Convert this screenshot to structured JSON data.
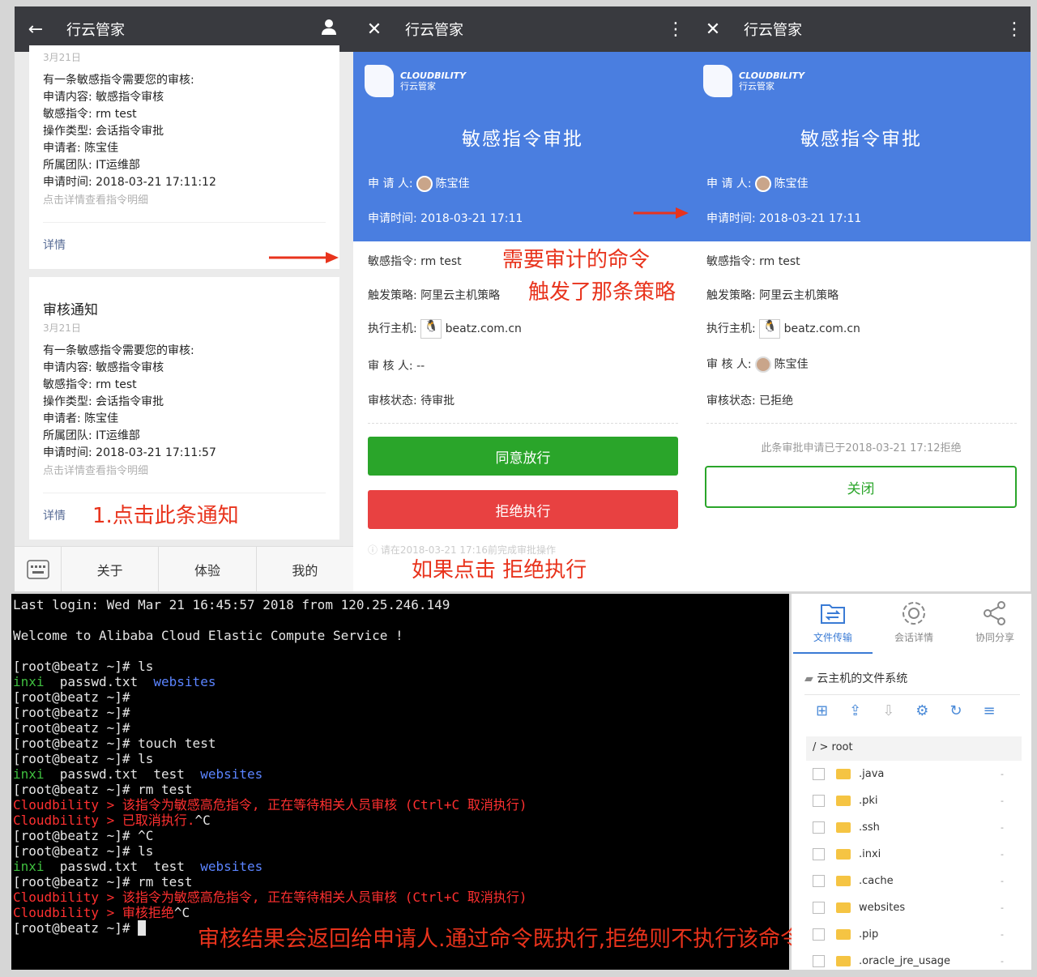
{
  "panel1": {
    "header": {
      "title": "行云管家"
    },
    "card1": {
      "date": "3月21日",
      "lines": [
        "有一条敏感指令需要您的审核:",
        "申请内容: 敏感指令审核",
        "敏感指令: rm test",
        "操作类型: 会话指令审批",
        "申请者: 陈宝佳",
        "所属团队: IT运维部",
        "申请时间: 2018-03-21 17:11:12"
      ],
      "hint": "点击详情查看指令明细",
      "detail": "详情"
    },
    "card2": {
      "title": "审核通知",
      "date": "3月21日",
      "lines": [
        "有一条敏感指令需要您的审核:",
        "申请内容: 敏感指令审核",
        "敏感指令: rm test",
        "操作类型: 会话指令审批",
        "申请者: 陈宝佳",
        "所属团队: IT运维部",
        "申请时间: 2018-03-21 17:11:57"
      ],
      "hint": "点击详情查看指令明细",
      "detail": "详情"
    },
    "annotation": "1.点击此条通知",
    "bottom_menu": [
      "关于",
      "体验",
      "我的"
    ]
  },
  "brand": {
    "name": "CLOUDBILITY",
    "sub": "行云管家"
  },
  "panel2": {
    "header": {
      "title": "行云管家"
    },
    "title": "敏感指令审批",
    "applicant_label": "申 请 人:",
    "applicant": "陈宝佳",
    "time": "申请时间: 2018-03-21 17:11",
    "command": "敏感指令: rm test",
    "policy": "触发策略: 阿里云主机策略",
    "host_label": "执行主机:",
    "host": "beatz.com.cn",
    "reviewer": "审 核 人: --",
    "status": "审核状态: 待审批",
    "approve": "同意放行",
    "reject": "拒绝执行",
    "notice": "请在2018-03-21 17:16前完成审批操作",
    "annotations": {
      "cmd": "需要审计的命令",
      "policy": "触发了那条策略",
      "reject": "如果点击 拒绝执行"
    }
  },
  "panel3": {
    "header": {
      "title": "行云管家"
    },
    "title": "敏感指令审批",
    "applicant_label": "申 请 人:",
    "applicant": "陈宝佳",
    "time": "申请时间: 2018-03-21 17:11",
    "command": "敏感指令: rm test",
    "policy": "触发策略: 阿里云主机策略",
    "host_label": "执行主机:",
    "host": "beatz.com.cn",
    "reviewer_label": "审 核 人:",
    "reviewer": "陈宝佳",
    "status": "审核状态: 已拒绝",
    "rejected_note": "此条审批申请已于2018-03-21 17:12拒绝",
    "close": "关闭"
  },
  "terminal": {
    "lines": [
      [
        [
          "w",
          "Last login: Wed Mar 21 16:45:57 2018 from 120.25.246.149"
        ]
      ],
      [
        [
          "w",
          ""
        ]
      ],
      [
        [
          "w",
          "Welcome to Alibaba Cloud Elastic Compute Service !"
        ]
      ],
      [
        [
          "w",
          ""
        ]
      ],
      [
        [
          "w",
          "[root@beatz ~]# ls"
        ]
      ],
      [
        [
          "g",
          "inxi"
        ],
        [
          "w",
          "  passwd.txt  "
        ],
        [
          "b",
          "websites"
        ]
      ],
      [
        [
          "w",
          "[root@beatz ~]#"
        ]
      ],
      [
        [
          "w",
          "[root@beatz ~]#"
        ]
      ],
      [
        [
          "w",
          "[root@beatz ~]#"
        ]
      ],
      [
        [
          "w",
          "[root@beatz ~]# touch test"
        ]
      ],
      [
        [
          "w",
          "[root@beatz ~]# ls"
        ]
      ],
      [
        [
          "g",
          "inxi"
        ],
        [
          "w",
          "  passwd.txt  test  "
        ],
        [
          "b",
          "websites"
        ]
      ],
      [
        [
          "w",
          "[root@beatz ~]# rm test"
        ]
      ],
      [
        [
          "r",
          "Cloudbility > 该指令为敏感高危指令, 正在等待相关人员审核 (Ctrl+C 取消执行)"
        ]
      ],
      [
        [
          "r",
          "Cloudbility > 已取消执行."
        ],
        [
          "w",
          "^C"
        ]
      ],
      [
        [
          "w",
          "[root@beatz ~]# ^C"
        ]
      ],
      [
        [
          "w",
          "[root@beatz ~]# ls"
        ]
      ],
      [
        [
          "g",
          "inxi"
        ],
        [
          "w",
          "  passwd.txt  test  "
        ],
        [
          "b",
          "websites"
        ]
      ],
      [
        [
          "w",
          "[root@beatz ~]# rm test"
        ]
      ],
      [
        [
          "r",
          "Cloudbility > 该指令为敏感高危指令, 正在等待相关人员审核 (Ctrl+C 取消执行)"
        ]
      ],
      [
        [
          "r",
          "Cloudbility > 审核拒绝"
        ],
        [
          "w",
          "^C"
        ]
      ],
      [
        [
          "w",
          "[root@beatz ~]# █"
        ]
      ]
    ],
    "annotation": "审核结果会返回给申请人.通过命令既执行,拒绝则不执行该命令"
  },
  "files": {
    "tabs": [
      "文件传输",
      "会话详情",
      "协同分享"
    ],
    "title": "云主机的文件系统",
    "path": "/ > root",
    "items": [
      ".java",
      ".pki",
      ".ssh",
      ".inxi",
      ".cache",
      "websites",
      ".pip",
      ".oracle_jre_usage"
    ],
    "size": "-"
  }
}
